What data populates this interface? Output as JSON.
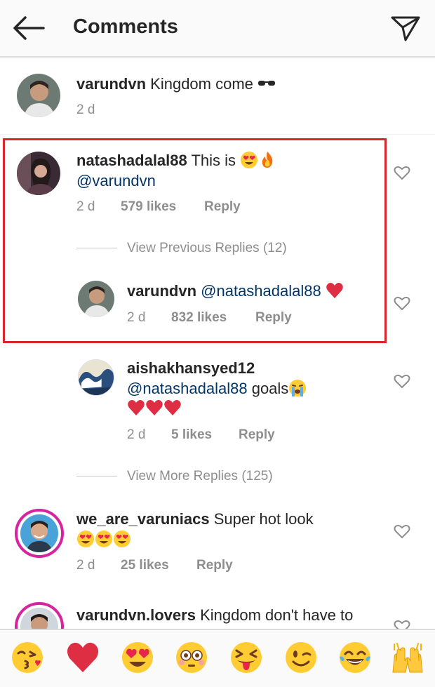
{
  "header": {
    "title": "Comments"
  },
  "comments": [
    {
      "user": "varundvn",
      "text": "Kingdom come",
      "time": "2 d"
    },
    {
      "user": "natashadalal88",
      "text": "This is",
      "mention": "@varundvn",
      "time": "2 d",
      "likes": "579 likes",
      "reply": "Reply"
    },
    {
      "view_replies": "View Previous Replies (12)"
    },
    {
      "user": "varundvn",
      "mention": "@natashadalal88",
      "time": "2 d",
      "likes": "832 likes",
      "reply": "Reply"
    },
    {
      "user": "aishakhansyed12",
      "mention": "@natashadalal88",
      "text": "goals",
      "time": "2 d",
      "likes": "5 likes",
      "reply": "Reply"
    },
    {
      "view_replies": "View More Replies (125)"
    },
    {
      "user": "we_are_varuniacs",
      "text": "Super hot look",
      "time": "2 d",
      "likes": "25 likes",
      "reply": "Reply"
    },
    {
      "user": "varundvn.lovers",
      "text": "Kingdom don't have to"
    }
  ],
  "emoji_bar": [
    "kissing-heart",
    "red-heart",
    "heart-eyes",
    "flushed",
    "tongue-squint",
    "wink",
    "tears-of-joy",
    "raised-hands"
  ],
  "colors": {
    "highlight_box": "#d9262b",
    "mention": "#003569",
    "story_ring": "#d6249f",
    "meta": "#8e8e8e"
  }
}
